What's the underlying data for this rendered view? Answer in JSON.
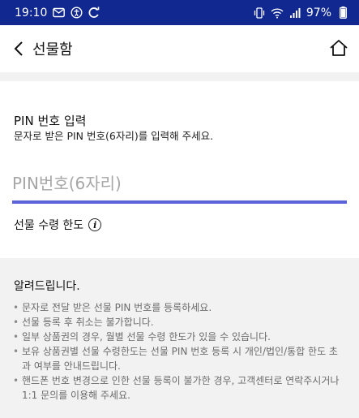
{
  "status_bar": {
    "time": "19:10",
    "battery": "97%",
    "left_icons": [
      "mail-icon",
      "accessibility-icon",
      "sync-icon"
    ],
    "right_icons": [
      "vibrate-icon",
      "wifi-icon",
      "signal-icon"
    ]
  },
  "header": {
    "title": "선물함",
    "back_icon": "chevron-left-icon",
    "home_icon": "home-icon"
  },
  "pin_section": {
    "heading": "PIN 번호 입력",
    "description": "문자로 받은 PIN 번호(6자리)를 입력해 주세요.",
    "input_placeholder": "PIN번호(6자리)",
    "input_value": "",
    "limit_label": "선물 수령 한도",
    "info_icon": "info-icon"
  },
  "notice": {
    "title": "알려드립니다.",
    "items": [
      "문자로 전달 받은 선물 PIN 번호를 등록하세요.",
      "선물 등록 후 취소는 불가합니다.",
      "일부 상품권의 경우, 월별 선물 수령 한도가 있을 수 있습니다.",
      "보유 상품권별 선물 수령한도는 선물 PIN 번호 등록 시 개인/법인/통합 한도 초과 여부를 안내드립니다.",
      "핸드폰 번호 변경으로 인한 선물 등록이 불가한 경우, 고객센터로 연락주시거나 1:1 문의를 이용해 주세요."
    ]
  },
  "colors": {
    "status_bar": "#10288f",
    "input_underline": "#5a63d6",
    "section_background": "#f2f2f2"
  }
}
